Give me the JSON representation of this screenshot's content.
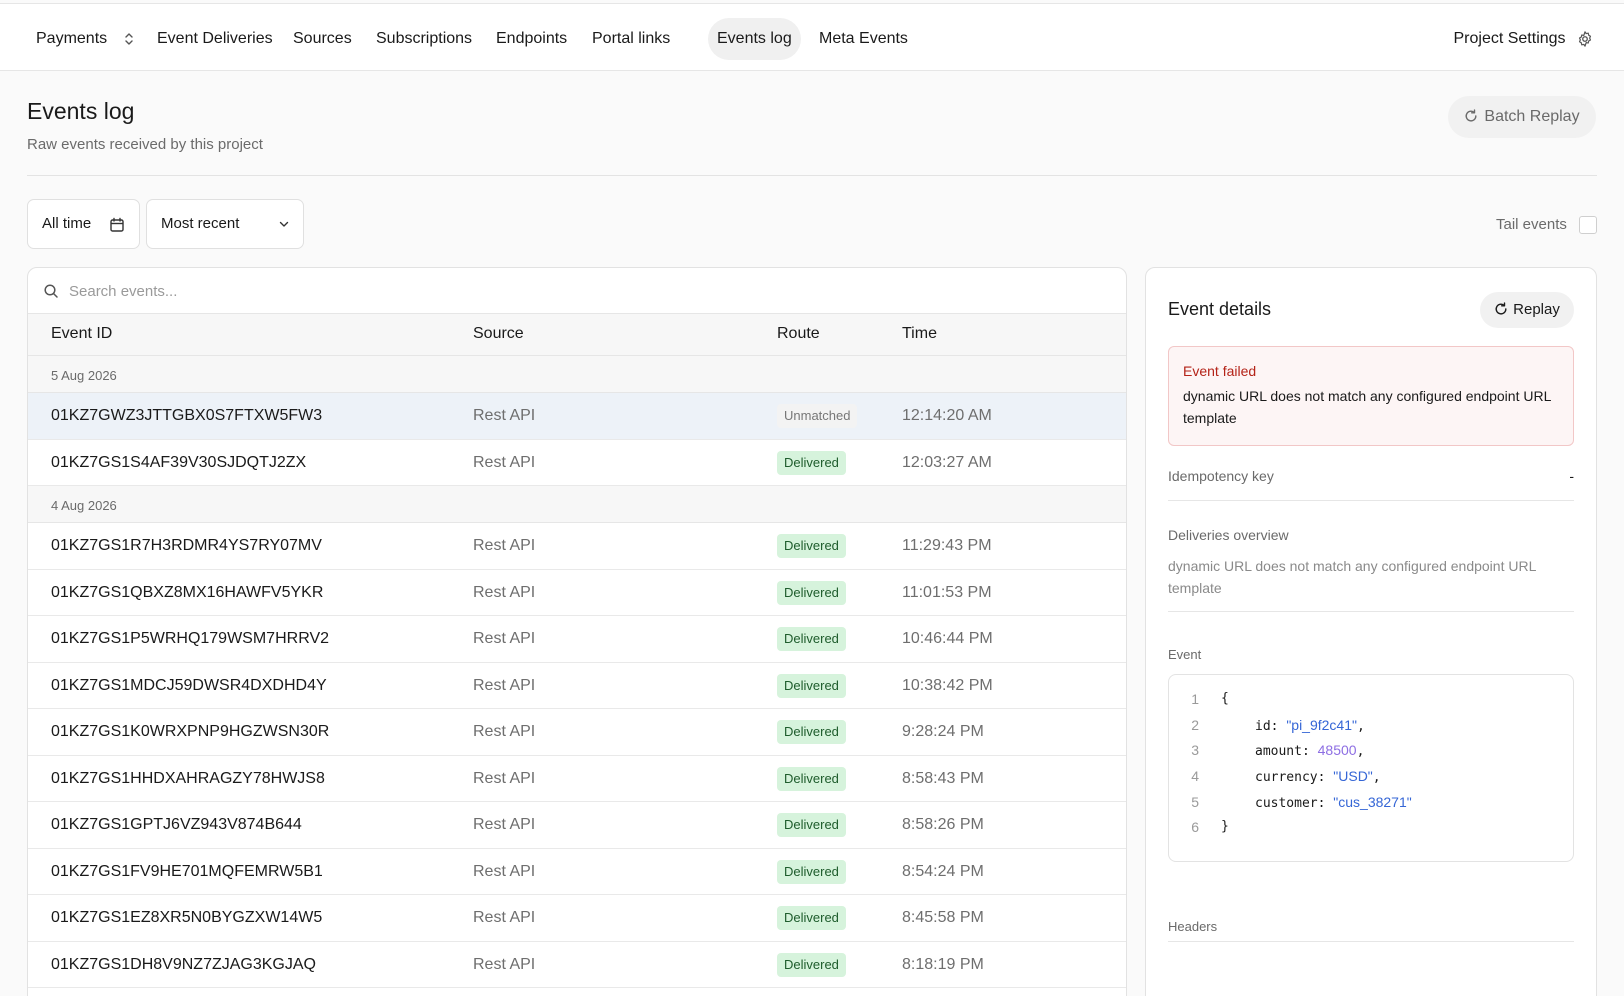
{
  "nav": {
    "project": "Payments",
    "items": [
      {
        "label": "Event Deliveries"
      },
      {
        "label": "Sources"
      },
      {
        "label": "Subscriptions"
      },
      {
        "label": "Endpoints"
      },
      {
        "label": "Portal links"
      },
      {
        "label": "Events log"
      },
      {
        "label": "Meta Events"
      }
    ],
    "active": "Events log",
    "settings_label": "Project Settings"
  },
  "page": {
    "title": "Events log",
    "subtitle": "Raw events received by this project",
    "batch_replay_label": "Batch Replay"
  },
  "filters": {
    "time_label": "All time",
    "sort_label": "Most recent",
    "tail_label": "Tail events",
    "tail_checked": false
  },
  "table": {
    "search_placeholder": "Search events...",
    "columns": {
      "id": "Event ID",
      "source": "Source",
      "route": "Route",
      "time": "Time"
    },
    "groups": [
      {
        "date": "5 Aug 2026",
        "rows": [
          {
            "id": "01KZ7GWZ3JTTGBX0S7FTXW5FW3",
            "source": "Rest API",
            "route": "Unmatched",
            "time": "12:14:20 AM"
          },
          {
            "id": "01KZ7GS1S4AF39V30SJDQTJ2ZX",
            "source": "Rest API",
            "route": "Delivered",
            "time": "12:03:27 AM"
          }
        ]
      },
      {
        "date": "4 Aug 2026",
        "rows": [
          {
            "id": "01KZ7GS1R7H3RDMR4YS7RY07MV",
            "source": "Rest API",
            "route": "Delivered",
            "time": "11:29:43 PM"
          },
          {
            "id": "01KZ7GS1QBXZ8MX16HAWFV5YKR",
            "source": "Rest API",
            "route": "Delivered",
            "time": "11:01:53 PM"
          },
          {
            "id": "01KZ7GS1P5WRHQ179WSM7HRRV2",
            "source": "Rest API",
            "route": "Delivered",
            "time": "10:46:44 PM"
          },
          {
            "id": "01KZ7GS1MDCJ59DWSR4DXDHD4Y",
            "source": "Rest API",
            "route": "Delivered",
            "time": "10:38:42 PM"
          },
          {
            "id": "01KZ7GS1K0WRXPNP9HGZWSN30R",
            "source": "Rest API",
            "route": "Delivered",
            "time": "9:28:24 PM"
          },
          {
            "id": "01KZ7GS1HHDXAHRAGZY78HWJS8",
            "source": "Rest API",
            "route": "Delivered",
            "time": "8:58:43 PM"
          },
          {
            "id": "01KZ7GS1GPTJ6VZ943V874B644",
            "source": "Rest API",
            "route": "Delivered",
            "time": "8:58:26 PM"
          },
          {
            "id": "01KZ7GS1FV9HE701MQFEMRW5B1",
            "source": "Rest API",
            "route": "Delivered",
            "time": "8:54:24 PM"
          },
          {
            "id": "01KZ7GS1EZ8XR5N0BYGZXW14W5",
            "source": "Rest API",
            "route": "Delivered",
            "time": "8:45:58 PM"
          },
          {
            "id": "01KZ7GS1DH8V9NZ7ZJAG3KGJAQ",
            "source": "Rest API",
            "route": "Delivered",
            "time": "8:18:19 PM"
          }
        ]
      }
    ],
    "selected_id": "01KZ7GWZ3JTTGBX0S7FTXW5FW3"
  },
  "details": {
    "title": "Event details",
    "replay_label": "Replay",
    "error_title": "Event failed",
    "error_message": "dynamic URL does not match any configured endpoint URL template",
    "idempotency_label": "Idempotency key",
    "idempotency_value": "-",
    "deliveries_label": "Deliveries overview",
    "deliveries_message": "dynamic URL does not match any configured endpoint URL template",
    "event_label": "Event",
    "event_lines": [
      {
        "n": "1",
        "text": "{"
      },
      {
        "n": "2",
        "key": "id",
        "value": "\"pi_9f2c41\"",
        "type": "string",
        "comma": ","
      },
      {
        "n": "3",
        "key": "amount",
        "value": "48500",
        "type": "number",
        "comma": ","
      },
      {
        "n": "4",
        "key": "currency",
        "value": "\"USD\"",
        "type": "string",
        "comma": ","
      },
      {
        "n": "5",
        "key": "customer",
        "value": "\"cus_38271\"",
        "type": "string",
        "comma": ""
      },
      {
        "n": "6",
        "text": "}"
      }
    ],
    "headers_label": "Headers"
  },
  "colors": {
    "delivered_bg": "#d6f3dc",
    "error_text": "#b42318",
    "code_string": "#3566d6",
    "code_number": "#8d6ee3"
  }
}
